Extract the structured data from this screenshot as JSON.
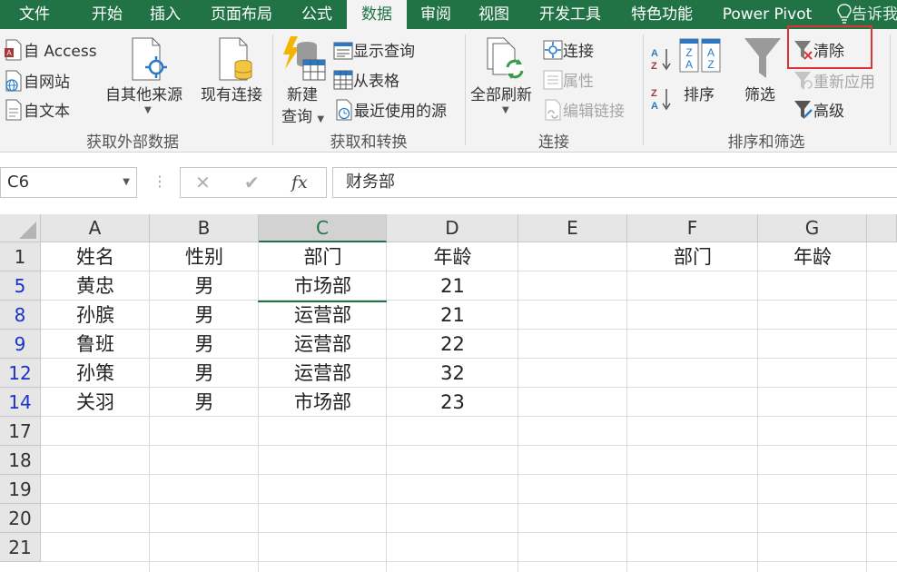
{
  "menu": {
    "tabs": [
      "文件",
      "开始",
      "插入",
      "页面布局",
      "公式",
      "数据",
      "审阅",
      "视图",
      "开发工具",
      "特色功能",
      "Power Pivot"
    ],
    "active_tab": "数据",
    "tell_me": "告诉我"
  },
  "ribbon": {
    "get_external": {
      "title": "获取外部数据",
      "from_access": "自 Access",
      "from_web": "自网站",
      "from_text": "自文本",
      "from_other": "自其他来源",
      "existing": "现有连接"
    },
    "get_transform": {
      "title": "获取和转换",
      "new_query_1": "新建",
      "new_query_2": "查询",
      "show_queries": "显示查询",
      "from_table": "从表格",
      "recent_sources": "最近使用的源"
    },
    "connections": {
      "title": "连接",
      "refresh_all": "全部刷新",
      "connections": "连接",
      "properties": "属性",
      "edit_links": "编辑链接"
    },
    "sort_filter": {
      "title": "排序和筛选",
      "sort": "排序",
      "filter": "筛选",
      "clear": "清除",
      "reapply": "重新应用",
      "advanced": "高级"
    },
    "highlight_color": "#e03232"
  },
  "formula_bar": {
    "name_box": "C6",
    "cancel_icon": "✕",
    "enter_icon": "✔",
    "fx_label": "fx",
    "value": "财务部"
  },
  "sheet": {
    "columns": [
      "A",
      "B",
      "C",
      "D",
      "E",
      "F",
      "G"
    ],
    "selected_column": "C",
    "rows": [
      {
        "num": "1",
        "filtered": false,
        "cells": [
          "姓名",
          "性别",
          "部门",
          "年龄",
          "",
          "部门",
          "年龄"
        ]
      },
      {
        "num": "5",
        "filtered": true,
        "cells": [
          "黄忠",
          "男",
          "市场部",
          "21",
          "",
          "",
          ""
        ]
      },
      {
        "num": "8",
        "filtered": true,
        "cells": [
          "孙膑",
          "男",
          "运营部",
          "21",
          "",
          "",
          ""
        ]
      },
      {
        "num": "9",
        "filtered": true,
        "cells": [
          "鲁班",
          "男",
          "运营部",
          "22",
          "",
          "",
          ""
        ]
      },
      {
        "num": "12",
        "filtered": true,
        "cells": [
          "孙策",
          "男",
          "运营部",
          "32",
          "",
          "",
          ""
        ]
      },
      {
        "num": "14",
        "filtered": true,
        "cells": [
          "关羽",
          "男",
          "市场部",
          "23",
          "",
          "",
          ""
        ]
      },
      {
        "num": "17",
        "filtered": false,
        "cells": [
          "",
          "",
          "",
          "",
          "",
          "",
          ""
        ]
      },
      {
        "num": "18",
        "filtered": false,
        "cells": [
          "",
          "",
          "",
          "",
          "",
          "",
          ""
        ]
      },
      {
        "num": "19",
        "filtered": false,
        "cells": [
          "",
          "",
          "",
          "",
          "",
          "",
          ""
        ]
      },
      {
        "num": "20",
        "filtered": false,
        "cells": [
          "",
          "",
          "",
          "",
          "",
          "",
          ""
        ]
      },
      {
        "num": "21",
        "filtered": false,
        "cells": [
          "",
          "",
          "",
          "",
          "",
          "",
          ""
        ]
      }
    ]
  },
  "colors": {
    "excel_green": "#217346",
    "filtered_row_number": "#1a32c8",
    "blue_icon": "#2b79c5"
  }
}
